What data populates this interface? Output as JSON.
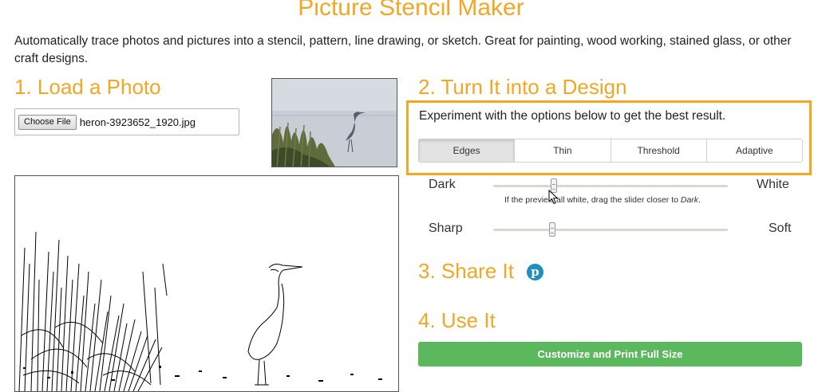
{
  "page": {
    "title": "Picture Stencil Maker",
    "intro": "Automatically trace photos and pictures into a stencil, pattern, line drawing, or sketch. Great for painting, wood working, stained glass, or other craft designs."
  },
  "step1": {
    "heading": "1. Load a Photo",
    "choose_file_label": "Choose File",
    "file_name": "heron-3923652_1920.jpg"
  },
  "step2": {
    "heading": "2. Turn It into a Design",
    "instructions": "Experiment with the options below to get the best result.",
    "modes": [
      "Edges",
      "Thin",
      "Threshold",
      "Adaptive"
    ],
    "active_mode": "Edges",
    "threshold_slider": {
      "left_label": "Dark",
      "right_label": "White",
      "value_fraction": 0.26,
      "hint_prefix": "If the previe",
      "hint_middle": "'s all white, drag the slider closer to ",
      "hint_emphasis": "Dark",
      "hint_suffix": "."
    },
    "smooth_slider": {
      "left_label": "Sharp",
      "right_label": "Soft",
      "value_fraction": 0.25
    }
  },
  "step3": {
    "heading": "3. Share It",
    "share_icon": "pinterest-icon"
  },
  "step4": {
    "heading": "4. Use It",
    "print_button_label": "Customize and Print Full Size"
  },
  "colors": {
    "accent": "#f5a623",
    "button_green": "#5cb85c",
    "pinterest": "#1f8fbf"
  }
}
